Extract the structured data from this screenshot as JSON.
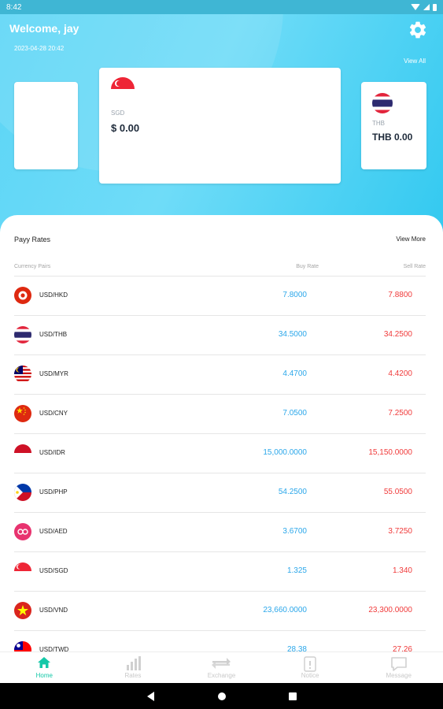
{
  "status_bar": {
    "time": "8:42"
  },
  "header": {
    "welcome": "Welcome, jay",
    "timestamp": "2023-04-28 20:42",
    "view_all": "View All",
    "icon": "gear-icon"
  },
  "wallet_cards": [
    {
      "flag": "singapore-flag-icon",
      "code": "SGD",
      "amount": "$ 0.00"
    },
    {
      "flag": "thailand-flag-icon",
      "code": "THB",
      "amount": "THB 0.00"
    }
  ],
  "rates": {
    "title": "Payy Rates",
    "view_more": "View More",
    "columns": [
      "Currency Pairs",
      "Buy Rate",
      "Sell Rate"
    ],
    "rows": [
      {
        "flag": "hong-kong-flag-icon",
        "pair": "USD/HKD",
        "buy": "7.8000",
        "sell": "7.8800"
      },
      {
        "flag": "thailand-flag-icon",
        "pair": "USD/THB",
        "buy": "34.5000",
        "sell": "34.2500"
      },
      {
        "flag": "malaysia-flag-icon",
        "pair": "USD/MYR",
        "buy": "4.4700",
        "sell": "4.4200"
      },
      {
        "flag": "china-flag-icon",
        "pair": "USD/CNY",
        "buy": "7.0500",
        "sell": "7.2500"
      },
      {
        "flag": "indonesia-flag-icon",
        "pair": "USD/IDR",
        "buy": "15,000.0000",
        "sell": "15,150.0000"
      },
      {
        "flag": "philippines-flag-icon",
        "pair": "USD/PHP",
        "buy": "54.2500",
        "sell": "55.0500"
      },
      {
        "flag": "uae-flag-icon",
        "pair": "USD/AED",
        "buy": "3.6700",
        "sell": "3.7250"
      },
      {
        "flag": "singapore-flag-icon",
        "pair": "USD/SGD",
        "buy": "1.325",
        "sell": "1.340"
      },
      {
        "flag": "vietnam-flag-icon",
        "pair": "USD/VND",
        "buy": "23,660.0000",
        "sell": "23,300.0000"
      },
      {
        "flag": "taiwan-flag-icon",
        "pair": "USD/TWD",
        "buy": "28.38",
        "sell": "27.26"
      }
    ]
  },
  "tabs": [
    {
      "label": "Home",
      "icon": "home-icon",
      "active": true
    },
    {
      "label": "Rates",
      "icon": "bar-chart-icon",
      "active": false
    },
    {
      "label": "Exchange",
      "icon": "exchange-icon",
      "active": false
    },
    {
      "label": "Notice",
      "icon": "notice-icon",
      "active": false
    },
    {
      "label": "Message",
      "icon": "message-icon",
      "active": false
    }
  ],
  "colors": {
    "accent": "#14c8a8",
    "buy": "#2ba7ea",
    "sell": "#f03a3a",
    "hero": "#5cd5f6"
  }
}
